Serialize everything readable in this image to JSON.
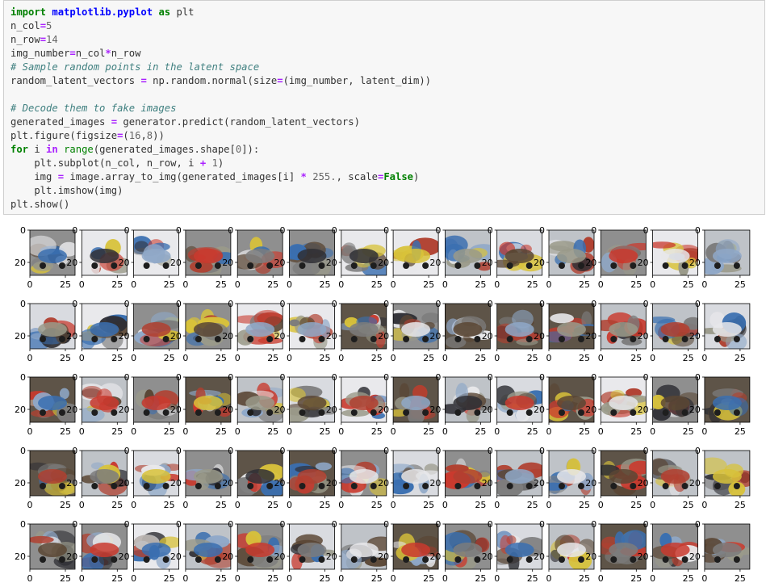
{
  "cell": {
    "lines": [
      [
        [
          "k",
          "import"
        ],
        [
          "",
          " "
        ],
        [
          "m",
          "matplotlib.pyplot"
        ],
        [
          "",
          " "
        ],
        [
          "k",
          "as"
        ],
        [
          "",
          " plt"
        ]
      ],
      [
        [
          "",
          "n_col"
        ],
        [
          "o",
          "="
        ],
        [
          "num",
          "5"
        ]
      ],
      [
        [
          "",
          "n_row"
        ],
        [
          "o",
          "="
        ],
        [
          "num",
          "14"
        ]
      ],
      [
        [
          "",
          "img_number"
        ],
        [
          "o",
          "="
        ],
        [
          "",
          "n_col"
        ],
        [
          "o",
          "*"
        ],
        [
          "",
          "n_row"
        ]
      ],
      [
        [
          "c",
          "# Sample random points in the latent space"
        ]
      ],
      [
        [
          "",
          "random_latent_vectors "
        ],
        [
          "o",
          "="
        ],
        [
          "",
          " np.random.normal(size"
        ],
        [
          "o",
          "="
        ],
        [
          "",
          "(img_number, latent_dim))"
        ]
      ],
      [
        [
          "",
          ""
        ]
      ],
      [
        [
          "c",
          "# Decode them to fake images"
        ]
      ],
      [
        [
          "",
          "generated_images "
        ],
        [
          "o",
          "="
        ],
        [
          "",
          " generator.predict(random_latent_vectors)"
        ]
      ],
      [
        [
          "",
          "plt.figure(figsize"
        ],
        [
          "o",
          "="
        ],
        [
          "",
          "("
        ],
        [
          "num",
          "16"
        ],
        [
          "",
          ","
        ],
        [
          "num",
          "8"
        ],
        [
          "",
          "))"
        ]
      ],
      [
        [
          "k",
          "for"
        ],
        [
          "",
          " i "
        ],
        [
          "o",
          "in"
        ],
        [
          "",
          " "
        ],
        [
          "n",
          "range"
        ],
        [
          "",
          "(generated_images.shape["
        ],
        [
          "num",
          "0"
        ],
        [
          "",
          "]):"
        ]
      ],
      [
        [
          "",
          "    plt.subplot(n_col, n_row, i "
        ],
        [
          "o",
          "+"
        ],
        [
          "",
          " "
        ],
        [
          "num",
          "1"
        ],
        [
          "",
          ")"
        ]
      ],
      [
        [
          "",
          "    img "
        ],
        [
          "o",
          "="
        ],
        [
          "",
          " image.array_to_img(generated_images[i] "
        ],
        [
          "o",
          "*"
        ],
        [
          "",
          " "
        ],
        [
          "num",
          "255."
        ],
        [
          "",
          ", scale"
        ],
        [
          "o",
          "="
        ],
        [
          "k",
          "False"
        ],
        [
          "",
          ")"
        ]
      ],
      [
        [
          "",
          "    plt.imshow(img)"
        ]
      ],
      [
        [
          "",
          "plt.show()"
        ]
      ]
    ]
  },
  "figure": {
    "rows": 5,
    "cols": 14,
    "ytick_labels": [
      "0",
      "20"
    ],
    "xtick_labels": [
      "0",
      "25"
    ],
    "palette": [
      "#3a6fb0",
      "#c93a2e",
      "#d8c23a",
      "#7c7c7c",
      "#e8e8ea",
      "#5a4634",
      "#8fa8c8",
      "#b04030",
      "#2f2f35",
      "#9a9a8a"
    ]
  }
}
